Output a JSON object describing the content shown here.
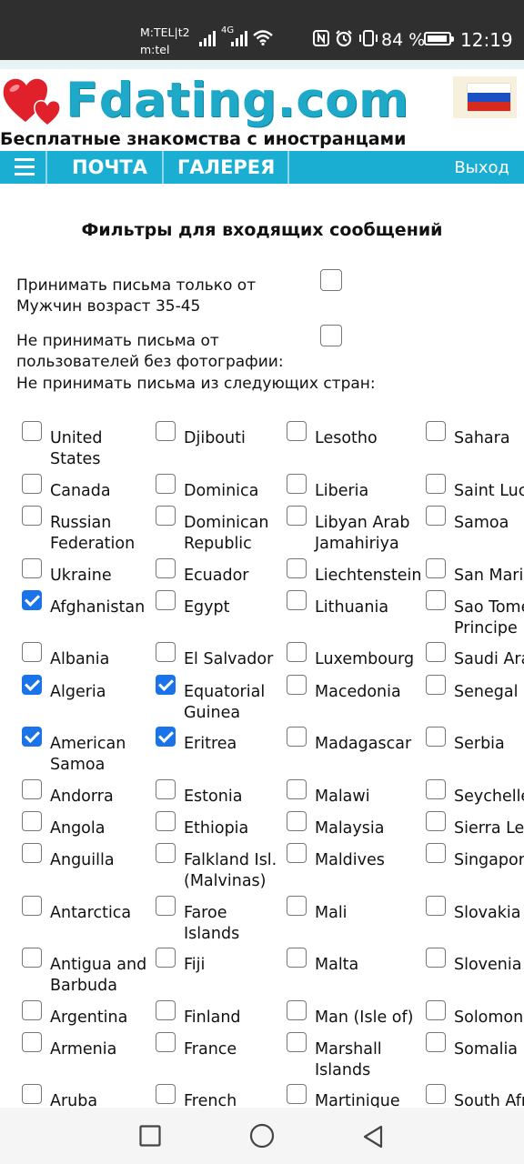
{
  "status_bar": {
    "carrier_line1": "M:TEL|t2",
    "carrier_line2": "m:tel",
    "network": "4G",
    "battery_percent": "84 %",
    "battery_level": 0.84,
    "time": "12:19",
    "icons": [
      "signal-icon",
      "wifi-icon",
      "nfc-icon",
      "alarm-icon",
      "vibrate-icon",
      "battery-icon"
    ]
  },
  "header": {
    "logo_text": "Fdating.com",
    "tagline": "Бесплатные знакомства с иностранцами",
    "language_flag": "russia-flag-icon"
  },
  "nav": {
    "menu_icon": "hamburger-icon",
    "items": [
      "ПОЧТА",
      "ГАЛЕРЕЯ"
    ],
    "exit": "Выход"
  },
  "filters": {
    "title": "Фильтры для входящих сообщений",
    "options": [
      {
        "label_line1": "Принимать письма только от",
        "label_line2": "Мужчин возраст 35-45",
        "checked": false
      },
      {
        "label_line1": "Не принимать письма от",
        "label_line2": "пользователей без фотографии:",
        "checked": false
      }
    ],
    "countries_title": "Не принимать письма из следующих стран:"
  },
  "countries": [
    {
      "name": "United States",
      "checked": false
    },
    {
      "name": "Canada",
      "checked": false
    },
    {
      "name": "Russian Federation",
      "checked": false
    },
    {
      "name": "Ukraine",
      "checked": false
    },
    {
      "name": "Afghanistan",
      "checked": true
    },
    {
      "name": "Albania",
      "checked": false
    },
    {
      "name": "Algeria",
      "checked": true
    },
    {
      "name": "American Samoa",
      "checked": true
    },
    {
      "name": "Andorra",
      "checked": false
    },
    {
      "name": "Angola",
      "checked": false
    },
    {
      "name": "Anguilla",
      "checked": false
    },
    {
      "name": "Antarctica",
      "checked": false
    },
    {
      "name": "Antigua and Barbuda",
      "checked": false
    },
    {
      "name": "Argentina",
      "checked": false
    },
    {
      "name": "Armenia",
      "checked": false
    },
    {
      "name": "Aruba",
      "checked": false
    },
    {
      "name": "Djibouti",
      "checked": false
    },
    {
      "name": "Dominica",
      "checked": false
    },
    {
      "name": "Dominican Republic",
      "checked": false
    },
    {
      "name": "Ecuador",
      "checked": false
    },
    {
      "name": "Egypt",
      "checked": false
    },
    {
      "name": "El Salvador",
      "checked": false
    },
    {
      "name": "Equatorial Guinea",
      "checked": true
    },
    {
      "name": "Eritrea",
      "checked": true
    },
    {
      "name": "Estonia",
      "checked": false
    },
    {
      "name": "Ethiopia",
      "checked": false
    },
    {
      "name": "Falkland Isl. (Malvinas)",
      "checked": false
    },
    {
      "name": "Faroe Islands",
      "checked": false
    },
    {
      "name": "Fiji",
      "checked": false
    },
    {
      "name": "Finland",
      "checked": false
    },
    {
      "name": "France",
      "checked": false
    },
    {
      "name": "French",
      "checked": false
    },
    {
      "name": "Lesotho",
      "checked": false
    },
    {
      "name": "Liberia",
      "checked": false
    },
    {
      "name": "Libyan Arab Jamahiriya",
      "checked": false
    },
    {
      "name": "Liechtenstein",
      "checked": false
    },
    {
      "name": "Lithuania",
      "checked": false
    },
    {
      "name": "Luxembourg",
      "checked": false
    },
    {
      "name": "Macedonia",
      "checked": false
    },
    {
      "name": "Madagascar",
      "checked": false
    },
    {
      "name": "Malawi",
      "checked": false
    },
    {
      "name": "Malaysia",
      "checked": false
    },
    {
      "name": "Maldives",
      "checked": false
    },
    {
      "name": "Mali",
      "checked": false
    },
    {
      "name": "Malta",
      "checked": false
    },
    {
      "name": "Man (Isle of)",
      "checked": false
    },
    {
      "name": "Marshall Islands",
      "checked": false
    },
    {
      "name": "Martinique",
      "checked": false
    },
    {
      "name": "Sahara",
      "checked": false
    },
    {
      "name": "Saint Lucia",
      "checked": false
    },
    {
      "name": "Samoa",
      "checked": false
    },
    {
      "name": "San Marino",
      "checked": false
    },
    {
      "name": "Sao Tome Principe",
      "checked": false
    },
    {
      "name": "Saudi Arabia",
      "checked": false
    },
    {
      "name": "Senegal",
      "checked": false
    },
    {
      "name": "Serbia",
      "checked": false
    },
    {
      "name": "Seychelles",
      "checked": false
    },
    {
      "name": "Sierra Leone",
      "checked": false
    },
    {
      "name": "Singapore",
      "checked": false
    },
    {
      "name": "Slovakia",
      "checked": false
    },
    {
      "name": "Slovenia",
      "checked": false
    },
    {
      "name": "Solomon",
      "checked": false
    },
    {
      "name": "Somalia",
      "checked": false
    },
    {
      "name": "South Africa",
      "checked": false
    }
  ],
  "colors": {
    "nav_bg": "#19aed2",
    "logo": "#1fa9c9",
    "checked": "#1a73e8",
    "heart": "#e0202a"
  },
  "system_nav": [
    "recent-apps-icon",
    "home-icon",
    "back-icon"
  ]
}
